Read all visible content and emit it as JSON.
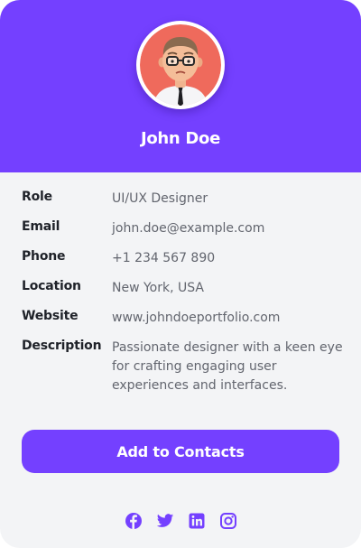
{
  "profile": {
    "name": "John Doe",
    "avatar": "cartoon-man-with-glasses"
  },
  "details": [
    {
      "label": "Role",
      "value": "UI/UX Designer"
    },
    {
      "label": "Email",
      "value": "john.doe@example.com"
    },
    {
      "label": "Phone",
      "value": "+1 234 567 890"
    },
    {
      "label": "Location",
      "value": "New York, USA"
    },
    {
      "label": "Website",
      "value": "www.johndoeportfolio.com"
    },
    {
      "label": "Description",
      "value": "Passionate designer with a keen eye for crafting engaging user experiences and interfaces."
    }
  ],
  "actions": {
    "add_contacts_label": "Add to Contacts"
  },
  "socials": [
    "facebook-icon",
    "twitter-icon",
    "linkedin-icon",
    "instagram-icon"
  ],
  "colors": {
    "accent": "#7440ff",
    "background": "#f3f4f6",
    "label": "#1f2229",
    "value": "#62656e"
  }
}
